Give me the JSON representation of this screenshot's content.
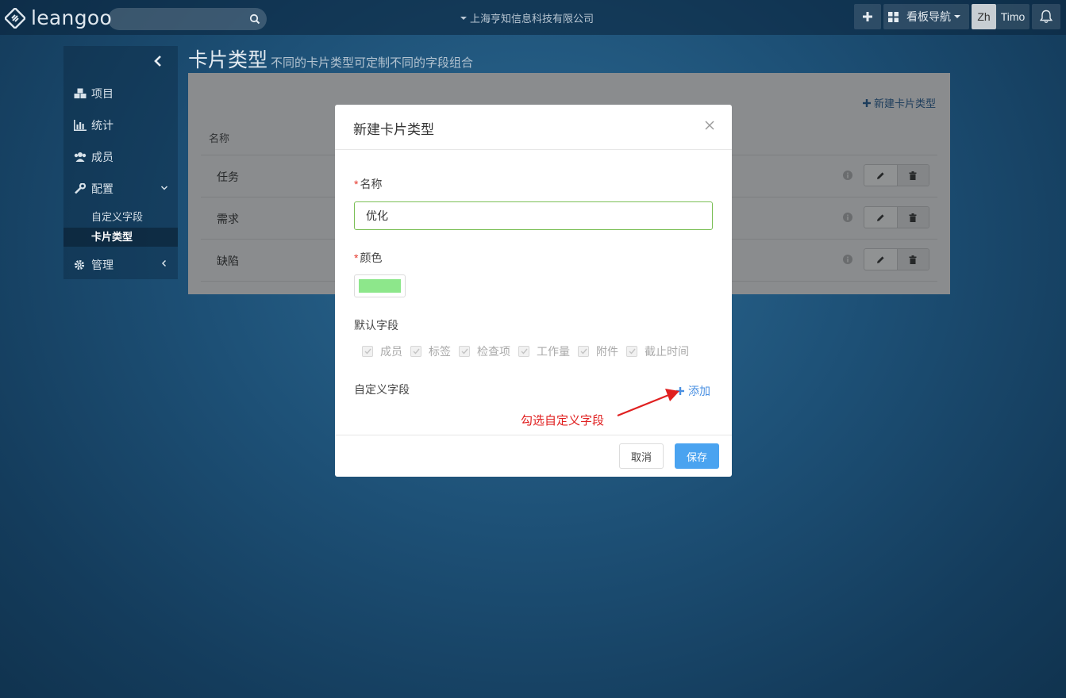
{
  "topbar": {
    "brand": "leangoo",
    "company": "上海亨知信息科技有限公司",
    "board_nav": "看板导航",
    "lang": "Zh",
    "user": "Timo"
  },
  "sidebar": {
    "items": [
      {
        "label": "项目",
        "icon": "cubes-icon"
      },
      {
        "label": "统计",
        "icon": "bar-chart-icon"
      },
      {
        "label": "成员",
        "icon": "users-icon"
      },
      {
        "label": "配置",
        "icon": "wrench-icon"
      }
    ],
    "config_children": [
      "自定义字段",
      "卡片类型"
    ],
    "manage": {
      "label": "管理",
      "icon": "gear-icon"
    }
  },
  "page": {
    "title": "卡片类型",
    "subtitle": "不同的卡片类型可定制不同的字段组合",
    "new_type_label": "新建卡片类型",
    "column_name": "名称",
    "rows": [
      "任务",
      "需求",
      "缺陷"
    ]
  },
  "modal": {
    "title": "新建卡片类型",
    "name_label": "名称",
    "name_value": "优化",
    "color_label": "颜色",
    "color_value": "#8de78b",
    "default_fields_label": "默认字段",
    "default_fields": [
      "成员",
      "标签",
      "检查项",
      "工作量",
      "附件",
      "截止时间"
    ],
    "custom_fields_label": "自定义字段",
    "add_label": "添加",
    "cancel_label": "取消",
    "save_label": "保存"
  },
  "annotation": {
    "text": "勾选自定义字段",
    "color": "#e02020"
  },
  "colors": {
    "accent": "#4aa3f0",
    "link": "#4a90e2",
    "input_border": "#7bbf56"
  }
}
